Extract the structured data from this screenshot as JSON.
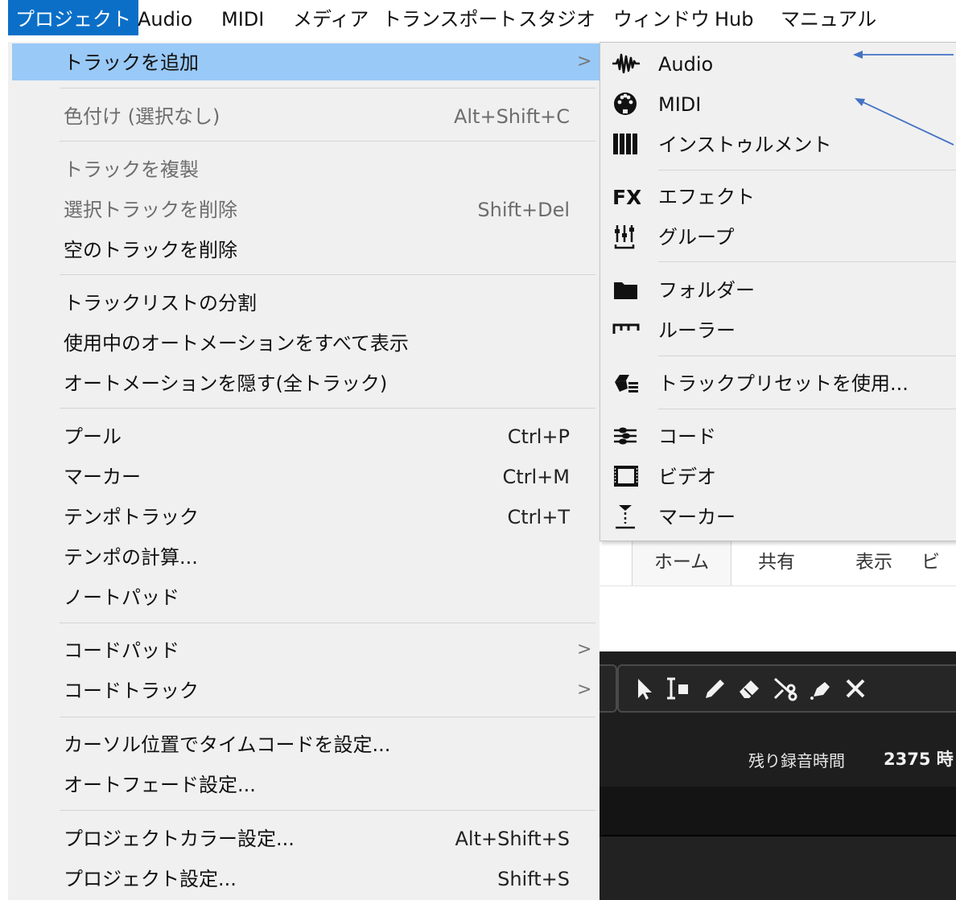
{
  "menubar": {
    "items": [
      "プロジェクト",
      "Audio",
      "MIDI",
      "メディア",
      "トランスポート",
      "スタジオ",
      "ウィンドウ",
      "Hub",
      "マニュアル"
    ]
  },
  "project_menu": {
    "items": [
      {
        "label": "トラックを追加",
        "submenu": true,
        "highlighted": true
      },
      {
        "label": "色付け (選択なし)",
        "shortcut": "Alt+Shift+C",
        "disabled": true
      },
      {
        "label": "トラックを複製",
        "disabled": true
      },
      {
        "label": "選択トラックを削除",
        "shortcut": "Shift+Del",
        "disabled": true
      },
      {
        "label": "空のトラックを削除"
      },
      {
        "label": "トラックリストの分割"
      },
      {
        "label": "使用中のオートメーションをすべて表示"
      },
      {
        "label": "オートメーションを隠す(全トラック)"
      },
      {
        "label": "プール",
        "shortcut": "Ctrl+P"
      },
      {
        "label": "マーカー",
        "shortcut": "Ctrl+M"
      },
      {
        "label": "テンポトラック",
        "shortcut": "Ctrl+T"
      },
      {
        "label": "テンポの計算..."
      },
      {
        "label": "ノートパッド"
      },
      {
        "label": "コードパッド",
        "submenu": true
      },
      {
        "label": "コードトラック",
        "submenu": true
      },
      {
        "label": "カーソル位置でタイムコードを設定..."
      },
      {
        "label": "オートフェード設定..."
      },
      {
        "label": "プロジェクトカラー設定...",
        "shortcut": "Alt+Shift+S"
      },
      {
        "label": "プロジェクト設定...",
        "shortcut": "Shift+S"
      }
    ]
  },
  "add_track_submenu": {
    "items": [
      {
        "label": "Audio",
        "icon": "audio-waveform-icon"
      },
      {
        "label": "MIDI",
        "icon": "midi-connector-icon"
      },
      {
        "label": "インストゥルメント",
        "icon": "piano-keys-icon"
      },
      {
        "label": "エフェクト",
        "icon": "fx-icon"
      },
      {
        "label": "グループ",
        "icon": "group-faders-icon"
      },
      {
        "label": "フォルダー",
        "icon": "folder-icon"
      },
      {
        "label": "ルーラー",
        "icon": "ruler-icon"
      },
      {
        "label": "トラックプリセットを使用...",
        "icon": "track-preset-icon"
      },
      {
        "label": "コード",
        "icon": "chord-icon"
      },
      {
        "label": "ビデオ",
        "icon": "video-film-icon"
      },
      {
        "label": "マーカー",
        "icon": "marker-icon"
      }
    ]
  },
  "background_app": {
    "ribbon_tabs": [
      "ホーム",
      "共有",
      "表示",
      "ビ"
    ],
    "toolbar_tools": [
      "arrow-select-icon",
      "range-select-icon",
      "pencil-icon",
      "eraser-icon",
      "split-scissors-icon",
      "glue-icon",
      "mute-x-icon"
    ],
    "remaining_rec_label": "残り録音時間",
    "remaining_rec_value": "2375 時"
  },
  "annotation_arrow_color": "#4472c4"
}
